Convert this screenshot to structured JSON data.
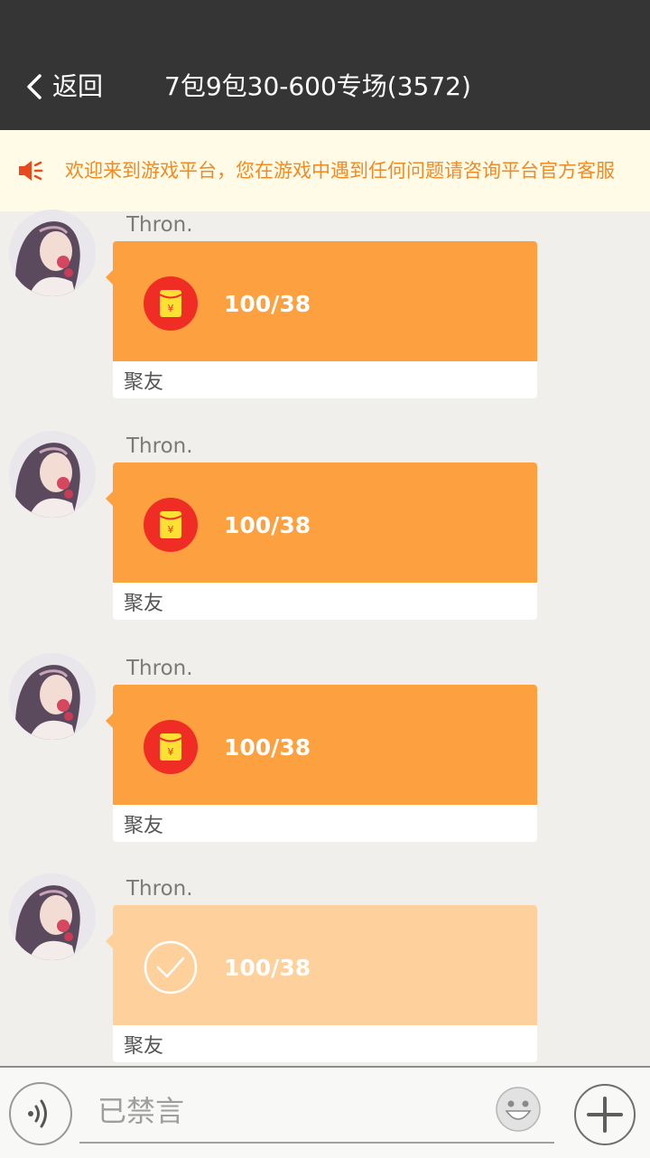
{
  "header": {
    "back_label": "返回",
    "title": "7包9包30-600专场(3572)"
  },
  "notice": {
    "text": "欢迎来到游戏平台，您在游戏中遇到任何问题请咨询平台官方客服"
  },
  "messages": [
    {
      "sender": "Thron.",
      "amount": "100/38",
      "from": "聚友",
      "opened": false
    },
    {
      "sender": "Thron.",
      "amount": "100/38",
      "from": "聚友",
      "opened": false
    },
    {
      "sender": "Thron.",
      "amount": "100/38",
      "from": "聚友",
      "opened": false
    },
    {
      "sender": "Thron.",
      "amount": "100/38",
      "from": "聚友",
      "opened": true
    }
  ],
  "input": {
    "placeholder": "已禁言"
  },
  "colors": {
    "header_bg": "#353535",
    "envelope_unopened": "#fca040",
    "envelope_opened": "#fed09b",
    "notice_text": "#f08a24"
  },
  "icons": {
    "back": "chevron-left-icon",
    "notice": "speaker-icon",
    "envelope": "red-envelope-icon",
    "opened": "check-circle-icon",
    "voice": "voice-icon",
    "emoji": "smiley-icon",
    "plus": "plus-icon"
  }
}
